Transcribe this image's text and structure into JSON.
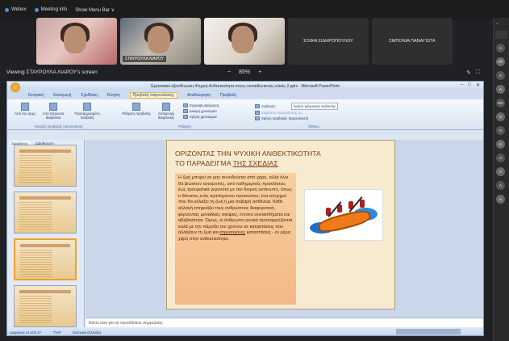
{
  "topbar": {
    "app_name": "Webex",
    "meeting_info": "Meeting info",
    "show_menu": "Show Menu Bar ∨"
  },
  "participants": {
    "tile1_name": "",
    "tile2_name": "ΣΤΑΥΡΟΥΛΑ ΛΙΑΡΟΥ",
    "tile4_name": "ΣΟΦΙΑ ΣΙΔΗΡΟΠΟΥΛΟΥ",
    "tile5_name": "ΣΜΠΟΝΙΑ ΠΑΝΑΓΙΩΤΑ"
  },
  "viewing": {
    "label": "Viewing ΣΤΑΥΡΟΥΛΑ ΛΙΑΡΟΥ's screen",
    "zoom_minus": "−",
    "zoom_value": "85%",
    "zoom_plus": "+"
  },
  "ppt": {
    "window_title": "Εργασιακό-εξανθένωση-Ψυχική-Ανθεκτικότητα-στους-εκπαιδευτικούς-ελκάς-2.pptx - Microsoft PowerPoint",
    "tabs": [
      "Κεντρική",
      "Εισαγωγή",
      "Σχεδίαση",
      "Κίνηση",
      "Προβολή παρουσίασης",
      "Αναθεώρηση",
      "Προβολή"
    ],
    "ribbon": {
      "btn1": "Από την αρχή",
      "btn2": "Από τρέχουσα διαφάνεια",
      "btn3": "Προσαρμοσμένη προβολή",
      "group1": "Έναρξη προβολής παρουσίασης",
      "btn4": "Ρύθμιση προβολής",
      "btn5": "Απόκρυψη διαφάνειας",
      "opt1": "Εγγραφή αφήγησης",
      "opt2": "Δοκιμή χρονισμού",
      "opt3": "Χρήση χρονισμών",
      "group2": "Ρύθμιση",
      "res_label": "Ανάλυση:",
      "res_value": "Χρήση τρέχουσας ανάλυσης",
      "show_on": "Εμφάνιση παρουσίασης σε:",
      "presenter_view": "Χρήση προβολής παρουσιαστή",
      "group3": "Οθόνες"
    },
    "pane_tabs": [
      "Διαφάνειες",
      "Διάρθρωση"
    ],
    "slide": {
      "title_line1": "ΟΡΙΖΟΝΤΑΣ ΤΗΝ ΨΥΧΙΚΗ ΑΝΘΕΚΤΙΚΟΤΗΤΑ",
      "title_line2_a": "ΤΟ ΠΑΡΑΔΕΙΓΜΑ ",
      "title_line2_b": "ΤΗΣ ΣΧΕΔΙΑΣ",
      "body_a": "Η ζωή μπορεί να μην συνοδεύεται από χάρη, αλλά όλοι θα βιώσουν ανατροπές, από καθημερινές προκλήσεις έως τραυματικά γεγονότα με πιο διαρκή αντίκτυπο, όπως ο θάνατος ενός αγαπημένου προσώπου, ένα ατύχημα που θα αλλάξει τη ζωή ή μια σοβαρή ασθένεια. Κάθε αλλαγή επηρεάζει τους ανθρώπους διαφορετικά, φέρνοντας μοναδικές σκέψεις, έντονα συναισθήματα και αβεβαιότητα. Όμως, οι άνθρωποι γενικά προσαρμόζονται καλά με την πάροδο του χρόνου σε καταστάσεις που αλλάζουν τη ζωή και ",
      "body_u": "στρεσογόνες",
      "body_b": " καταστάσεις - εν μέρει χάρη στην ανθεκτικότητα."
    },
    "notes_placeholder": "Κάντε κλικ για να προσθέσετε σημειώσεις",
    "status": {
      "slide_info": "Διαφάνεια 14 από 27",
      "theme": "\"Trek\"",
      "language": "Ελληνικά (Ελλάδα)"
    }
  }
}
